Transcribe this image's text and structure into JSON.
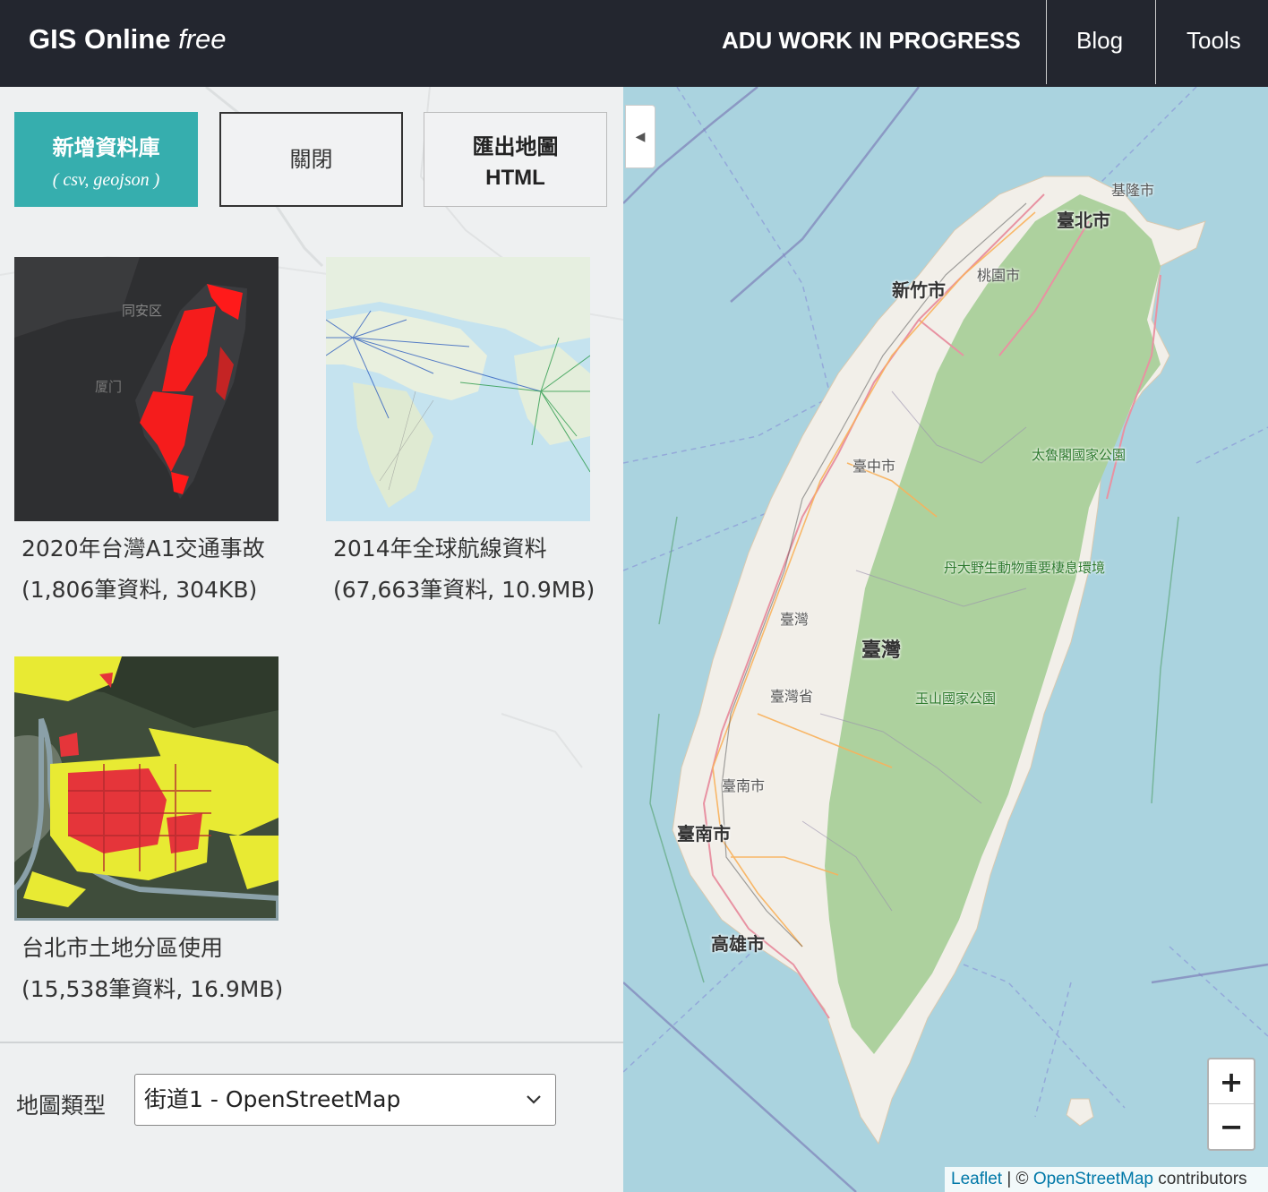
{
  "nav": {
    "brand_main": "GIS Online",
    "brand_em": "free",
    "wip": "ADU WORK IN PROGRESS",
    "blog": "Blog",
    "tools": "Tools"
  },
  "buttons": {
    "add_line1": "新增資料庫",
    "add_line2": "( csv, geojson )",
    "close": "關閉",
    "export_line1": "匯出地圖",
    "export_line2": "HTML"
  },
  "datasets": [
    {
      "title": "2020年台灣A1交通事故",
      "meta": "(1,806筆資料, 304KB)"
    },
    {
      "title": "2014年全球航線資料",
      "meta": "(67,663筆資料, 10.9MB)"
    },
    {
      "title": "台北市土地分區使用",
      "meta": "(15,538筆資料, 16.9MB)"
    }
  ],
  "maptype": {
    "label": "地圖類型",
    "selected": "街道1 - OpenStreetMap"
  },
  "map": {
    "labels": {
      "keelung": "基隆市",
      "taipei": "臺北市",
      "taoyuan": "桃園市",
      "hsinchu": "新竹市",
      "taichung": "臺中市",
      "taroko": "太魯閣國家公園",
      "dandaye": "丹大野生動物重要棲息環境",
      "taiwan1": "臺灣",
      "taiwan_big": "臺灣",
      "taiwan_prov": "臺灣省",
      "yushan": "玉山國家公園",
      "tainan_small": "臺南市",
      "tainan": "臺南市",
      "kaohsiung": "高雄市"
    },
    "collapse_icon": "◀",
    "zoom_in": "+",
    "zoom_out": "−",
    "attribution_leaflet": "Leaflet",
    "attribution_sep": " | © ",
    "attribution_osm": "OpenStreetMap",
    "attribution_tail": " contributors"
  },
  "colors": {
    "navbar": "#23262f",
    "accent": "#36aeae",
    "sea": "#aad3df",
    "land": "#f2efe9",
    "forest": "#add19e"
  }
}
